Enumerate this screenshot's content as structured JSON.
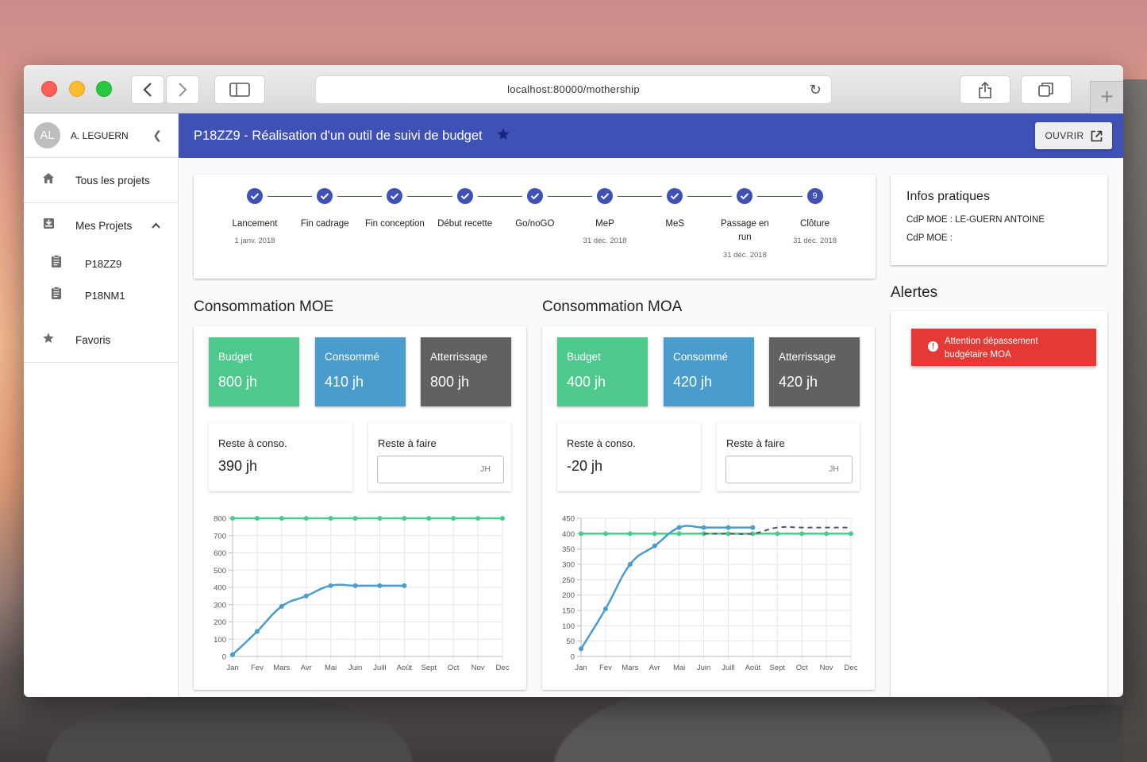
{
  "browser": {
    "url": "localhost:80000/mothership"
  },
  "sidebar": {
    "user": {
      "initials": "AL",
      "name": "A. LEGUERN"
    },
    "items": [
      {
        "label": "Tous les projets",
        "icon": "home-icon"
      },
      {
        "label": "Mes Projets",
        "icon": "inbox-icon"
      },
      {
        "label": "Favoris",
        "icon": "star-icon"
      }
    ],
    "projects": [
      {
        "label": "P18ZZ9",
        "icon": "clipboard-icon"
      },
      {
        "label": "P18NM1",
        "icon": "clipboard-icon"
      }
    ]
  },
  "header": {
    "title": "P18ZZ9 - Réalisation d'un outil de suivi de budget",
    "open_label": "OUVRIR"
  },
  "timeline": {
    "steps": [
      {
        "label": "Lancement",
        "date": "1 janv. 2018",
        "done": true
      },
      {
        "label": "Fin cadrage",
        "date": "",
        "done": true
      },
      {
        "label": "Fin conception",
        "date": "",
        "done": true
      },
      {
        "label": "Début recette",
        "date": "",
        "done": true
      },
      {
        "label": "Go/noGO",
        "date": "",
        "done": true
      },
      {
        "label": "MeP",
        "date": "31 déc. 2018",
        "done": true
      },
      {
        "label": "MeS",
        "date": "",
        "done": true
      },
      {
        "label": "Passage en run",
        "date": "31 déc. 2018",
        "done": true
      },
      {
        "label": "Clôture",
        "date": "31 déc. 2018",
        "done": false,
        "number": "9"
      }
    ]
  },
  "infos": {
    "title": "Infos pratiques",
    "line1": "CdP MOE : LE-GUERN ANTOINE",
    "line2": "CdP MOE :"
  },
  "alerts": {
    "title": "Alertes",
    "message_line1": "Attention dépassement",
    "message_line2": "budgétaire MOA"
  },
  "moe": {
    "title": "Consommation MOE",
    "budget_label": "Budget",
    "budget_value": "800 jh",
    "consomme_label": "Consommé",
    "consomme_value": "410 jh",
    "atterrissage_label": "Atterrissage",
    "atterrissage_value": "800 jh",
    "reste_conso_label": "Reste à conso.",
    "reste_conso_value": "390 jh",
    "reste_faire_label": "Reste à faire",
    "reste_faire_unit": "JH"
  },
  "moa": {
    "title": "Consommation MOA",
    "budget_label": "Budget",
    "budget_value": "400 jh",
    "consomme_label": "Consommé",
    "consomme_value": "420 jh",
    "atterrissage_label": "Atterrissage",
    "atterrissage_value": "420 jh",
    "reste_conso_label": "Reste à conso.",
    "reste_conso_value": "-20 jh",
    "reste_faire_label": "Reste à faire",
    "reste_faire_unit": "JH"
  },
  "colors": {
    "budget_line": "#4dc98e",
    "consumption_line": "#4a9ccc",
    "forecast_line": "#555555",
    "primary": "#3f51b5",
    "alert": "#e53935"
  },
  "chart_data": [
    {
      "type": "line",
      "categories": [
        "Jan",
        "Fev",
        "Mars",
        "Avr",
        "Mai",
        "Juin",
        "Juill",
        "Août",
        "Sept",
        "Oct",
        "Nov",
        "Dec"
      ],
      "ylim": [
        0,
        800
      ],
      "yticks": [
        0,
        100,
        200,
        300,
        400,
        500,
        600,
        700,
        800
      ],
      "grid": true,
      "series": [
        {
          "values": [
            800,
            800,
            800,
            800,
            800,
            800,
            800,
            800,
            800,
            800,
            800,
            800
          ],
          "color": "#4dc98e"
        },
        {
          "values": [
            10,
            145,
            290,
            350,
            410,
            410,
            410,
            410
          ],
          "color": "#4a9ccc"
        }
      ]
    },
    {
      "type": "line",
      "categories": [
        "Jan",
        "Fev",
        "Mars",
        "Avr",
        "Mai",
        "Juin",
        "Juill",
        "Août",
        "Sept",
        "Oct",
        "Nov",
        "Dec"
      ],
      "ylim": [
        0,
        450
      ],
      "yticks": [
        0,
        50,
        100,
        150,
        200,
        250,
        300,
        350,
        400,
        450
      ],
      "grid": true,
      "series": [
        {
          "values": [
            400,
            400,
            400,
            400,
            400,
            400,
            400,
            400,
            400,
            400,
            400,
            400
          ],
          "color": "#4dc98e"
        },
        {
          "values": [
            25,
            155,
            300,
            360,
            420,
            420,
            420,
            420
          ],
          "color": "#4a9ccc"
        },
        {
          "values": [
            null,
            null,
            null,
            null,
            null,
            400,
            400,
            400,
            420,
            420,
            420,
            420
          ],
          "color": "#555555",
          "dashed": true
        }
      ]
    }
  ]
}
